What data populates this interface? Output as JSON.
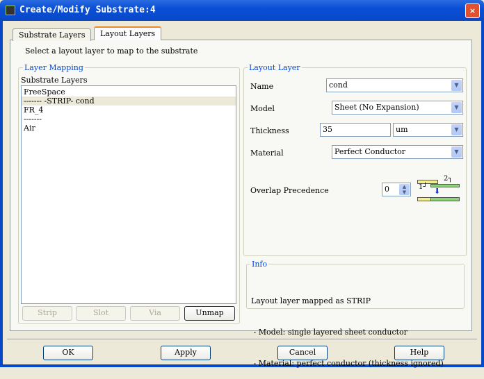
{
  "window": {
    "title": "Create/Modify Substrate:4",
    "close": "×"
  },
  "tabs": [
    {
      "label": "Substrate Layers"
    },
    {
      "label": "Layout Layers"
    }
  ],
  "instruction": "Select a layout layer to map to the substrate",
  "layer_mapping": {
    "legend": "Layer Mapping",
    "list_label": "Substrate Layers",
    "items": [
      "FreeSpace",
      "------- -STRIP- cond",
      "FR_4",
      "-------",
      "Air"
    ],
    "selected_index": 1,
    "buttons": {
      "strip": "Strip",
      "slot": "Slot",
      "via": "Via",
      "unmap": "Unmap"
    }
  },
  "layout_layer": {
    "legend": "Layout Layer",
    "name_label": "Name",
    "name_value": "cond",
    "model_label": "Model",
    "model_value": "Sheet (No Expansion)",
    "thickness_label": "Thickness",
    "thickness_value": "35",
    "thickness_unit": "um",
    "material_label": "Material",
    "material_value": "Perfect Conductor",
    "overlap_label": "Overlap Precedence",
    "overlap_value": "0",
    "diagram_label_1": "1┘",
    "diagram_label_2": "2┐"
  },
  "info": {
    "legend": "Info",
    "lines": [
      "Layout layer mapped as STRIP",
      " - Model: single layered sheet conductor",
      " - Material: perfect conductor (thickness ignored)"
    ]
  },
  "footer": {
    "ok": "OK",
    "apply": "Apply",
    "cancel": "Cancel",
    "help": "Help"
  },
  "colors": {
    "title_bar": "#0848c8",
    "legend": "#0046d5",
    "layer_yellow": "#f5ee8c",
    "layer_green": "#8fd47a"
  }
}
